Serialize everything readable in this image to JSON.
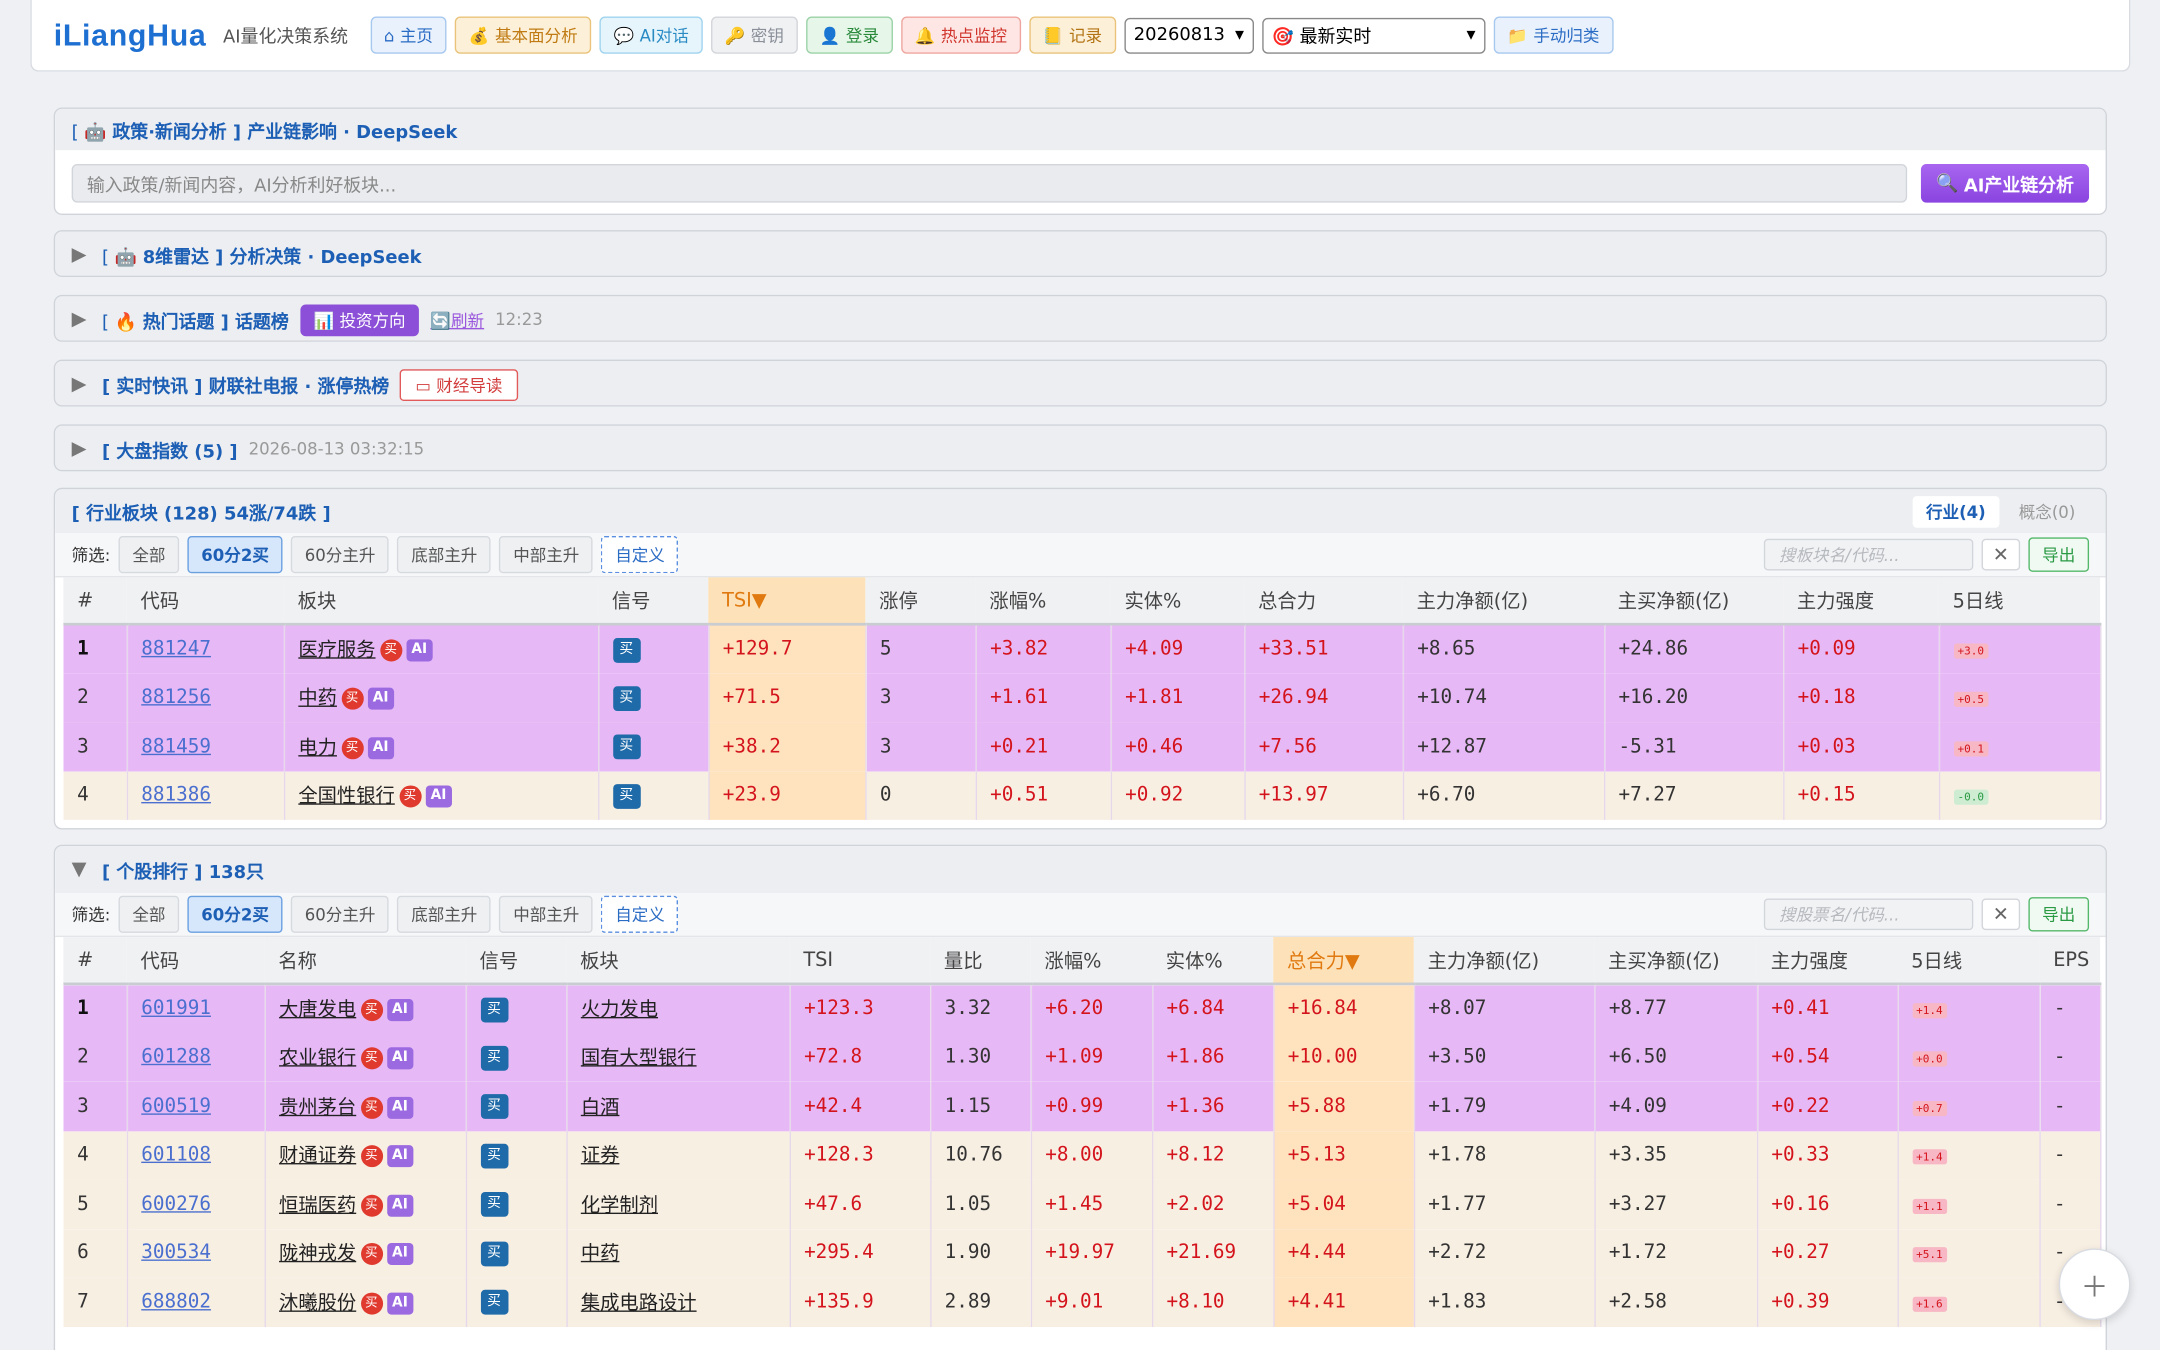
{
  "brand": {
    "logo": "iLiangHua",
    "subtitle": "AI量化决策系统"
  },
  "nav": {
    "home": "主页",
    "fundamental": "基本面分析",
    "ai_chat": "AI对话",
    "key": "密钥",
    "login": "登录",
    "hot_monitor": "热点监控",
    "record": "记录",
    "date": "20260813",
    "mode": "最新实时",
    "manual": "手动归类"
  },
  "policy": {
    "title_pre": "[ ",
    "title": "政策·新闻分析 ] 产业链影响 · DeepSeek",
    "placeholder": "输入政策/新闻内容，AI分析利好板块...",
    "button": "AI产业链分析"
  },
  "radar": {
    "title": "[ ",
    "label": "8维雷达 ] 分析决策 · DeepSeek"
  },
  "hot": {
    "label": "[ ",
    "title": "热门话题 ] 话题榜",
    "invest": "投资方向",
    "refresh": "刷新",
    "time": "12:23"
  },
  "flash": {
    "title": "[ 实时快讯 ] 财联社电报 · 涨停热榜",
    "reading": "财经导读"
  },
  "index": {
    "title": "[ 大盘指数 (5) ]",
    "time": "2026-08-13 03:32:15"
  },
  "industry": {
    "title": "[ 行业板块 (128) 54涨/74跌 ]",
    "tab_ind": "行业(4)",
    "tab_concept": "概念(0)",
    "filter_label": "筛选:",
    "filters": [
      "全部",
      "60分2买",
      "60分主升",
      "底部主升",
      "中部主升",
      "自定义"
    ],
    "search": "搜板块名/代码...",
    "export": "导出",
    "headers": [
      "#",
      "代码",
      "板块",
      "信号",
      "TSI▼",
      "涨停",
      "涨幅%",
      "实体%",
      "总合力",
      "主力净额(亿)",
      "主买净额(亿)",
      "主力强度",
      "5日线"
    ],
    "rows": [
      {
        "n": "1",
        "code": "881247",
        "name": "医疗服务",
        "sig": "买",
        "tsi": "+129.7",
        "zt": "5",
        "chg": "+3.82",
        "body": "+4.09",
        "force": "+33.51",
        "net": "+8.65",
        "buy": "+24.86",
        "str": "+0.09",
        "spark": "+3.0"
      },
      {
        "n": "2",
        "code": "881256",
        "name": "中药",
        "sig": "买",
        "tsi": "+71.5",
        "zt": "3",
        "chg": "+1.61",
        "body": "+1.81",
        "force": "+26.94",
        "net": "+10.74",
        "buy": "+16.20",
        "str": "+0.18",
        "spark": "+0.5"
      },
      {
        "n": "3",
        "code": "881459",
        "name": "电力",
        "sig": "买",
        "tsi": "+38.2",
        "zt": "3",
        "chg": "+0.21",
        "body": "+0.46",
        "force": "+7.56",
        "net": "+12.87",
        "buy": "-5.31",
        "str": "+0.03",
        "spark": "+0.1"
      },
      {
        "n": "4",
        "code": "881386",
        "name": "全国性银行",
        "sig": "买",
        "tsi": "+23.9",
        "zt": "0",
        "chg": "+0.51",
        "body": "+0.92",
        "force": "+13.97",
        "net": "+6.70",
        "buy": "+7.27",
        "str": "+0.15",
        "spark": "-0.0"
      }
    ]
  },
  "stocks": {
    "title": "[ 个股排行 ] 138只",
    "filter_label": "筛选:",
    "filters": [
      "全部",
      "60分2买",
      "60分主升",
      "底部主升",
      "中部主升",
      "自定义"
    ],
    "search": "搜股票名/代码...",
    "export": "导出",
    "headers": [
      "#",
      "代码",
      "名称",
      "信号",
      "板块",
      "TSI",
      "量比",
      "涨幅%",
      "实体%",
      "总合力▼",
      "主力净额(亿)",
      "主买净额(亿)",
      "主力强度",
      "5日线",
      "EPS"
    ],
    "rows": [
      {
        "n": "1",
        "code": "601991",
        "name": "大唐发电",
        "sig": "买",
        "sector": "火力发电",
        "tsi": "+123.3",
        "vr": "3.32",
        "chg": "+6.20",
        "body": "+6.84",
        "force": "+16.84",
        "net": "+8.07",
        "buy": "+8.77",
        "str": "+0.41",
        "spark": "+1.4",
        "eps": "-"
      },
      {
        "n": "2",
        "code": "601288",
        "name": "农业银行",
        "sig": "买",
        "sector": "国有大型银行",
        "tsi": "+72.8",
        "vr": "1.30",
        "chg": "+1.09",
        "body": "+1.86",
        "force": "+10.00",
        "net": "+3.50",
        "buy": "+6.50",
        "str": "+0.54",
        "spark": "+0.0",
        "eps": "-"
      },
      {
        "n": "3",
        "code": "600519",
        "name": "贵州茅台",
        "sig": "买",
        "sector": "白酒",
        "tsi": "+42.4",
        "vr": "1.15",
        "chg": "+0.99",
        "body": "+1.36",
        "force": "+5.88",
        "net": "+1.79",
        "buy": "+4.09",
        "str": "+0.22",
        "spark": "+0.7",
        "eps": "-"
      },
      {
        "n": "4",
        "code": "601108",
        "name": "财通证券",
        "sig": "买",
        "sector": "证券",
        "tsi": "+128.3",
        "vr": "10.76",
        "chg": "+8.00",
        "body": "+8.12",
        "force": "+5.13",
        "net": "+1.78",
        "buy": "+3.35",
        "str": "+0.33",
        "spark": "+1.4",
        "eps": "-"
      },
      {
        "n": "5",
        "code": "600276",
        "name": "恒瑞医药",
        "sig": "买",
        "sector": "化学制剂",
        "tsi": "+47.6",
        "vr": "1.05",
        "chg": "+1.45",
        "body": "+2.02",
        "force": "+5.04",
        "net": "+1.77",
        "buy": "+3.27",
        "str": "+0.16",
        "spark": "+1.1",
        "eps": "-"
      },
      {
        "n": "6",
        "code": "300534",
        "name": "陇神戎发",
        "sig": "买",
        "sector": "中药",
        "tsi": "+295.4",
        "vr": "1.90",
        "chg": "+19.97",
        "body": "+21.69",
        "force": "+4.44",
        "net": "+2.72",
        "buy": "+1.72",
        "str": "+0.27",
        "spark": "+5.1",
        "eps": "-"
      },
      {
        "n": "7",
        "code": "688802",
        "name": "沐曦股份",
        "sig": "买",
        "sector": "集成电路设计",
        "tsi": "+135.9",
        "vr": "2.89",
        "chg": "+9.01",
        "body": "+8.10",
        "force": "+4.41",
        "net": "+1.83",
        "buy": "+2.58",
        "str": "+0.39",
        "spark": "+1.6",
        "eps": "-"
      }
    ]
  }
}
